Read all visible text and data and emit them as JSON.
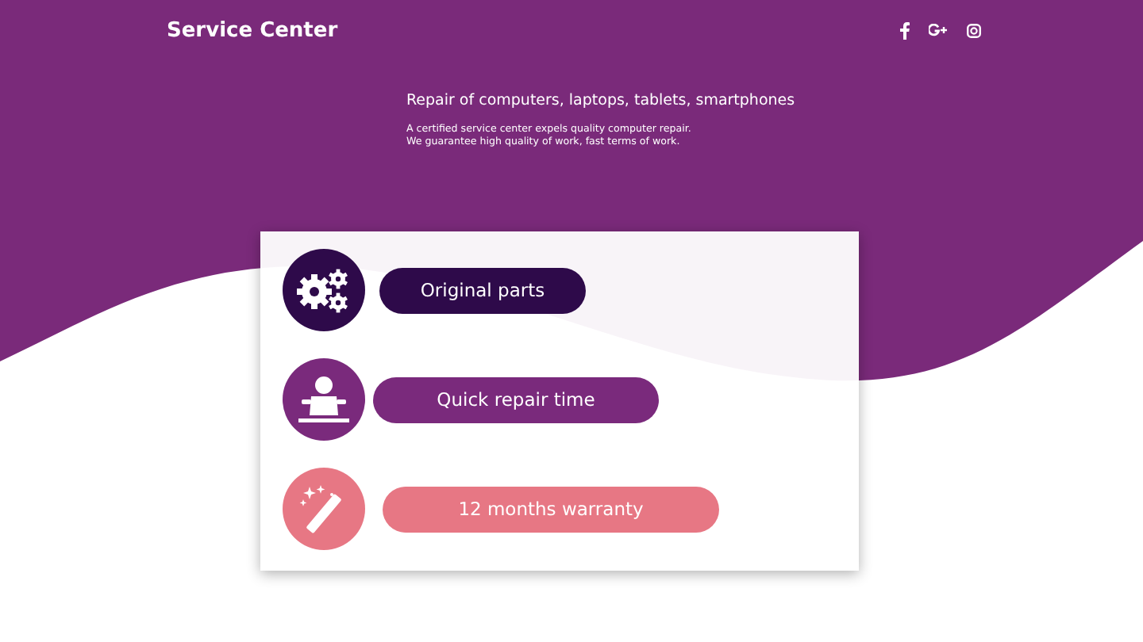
{
  "header": {
    "logo": "Service Center",
    "social": [
      {
        "kind": "facebook"
      },
      {
        "kind": "google-plus"
      },
      {
        "kind": "instagram"
      }
    ]
  },
  "hero": {
    "heading": "Repair of computers, laptops, tablets, smartphones",
    "lines": [
      "A certified service center expels quality computer repair.",
      "We guarantee high quality of work, fast terms of work."
    ]
  },
  "features": [
    {
      "kind": "gears",
      "label": "Original parts",
      "color": "#2e0a4a"
    },
    {
      "kind": "worker",
      "label": "Quick repair time",
      "color": "#7a2a7c"
    },
    {
      "kind": "wand",
      "label": "12 months warranty",
      "color": "#e77784"
    }
  ]
}
